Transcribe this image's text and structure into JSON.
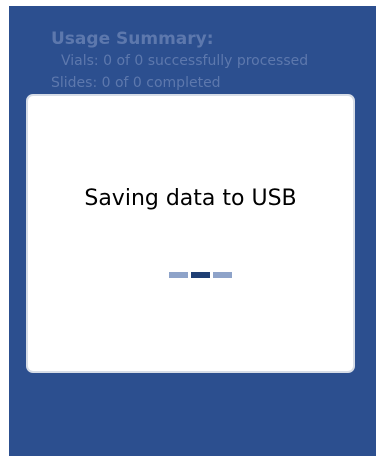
{
  "background_screen": {
    "usage_summary": {
      "title": "Usage Summary:",
      "vials_line": "Vials:  0 of 0 successfully processed",
      "slides_line": "Slides:  0 of 0 completed"
    }
  },
  "modal": {
    "message": "Saving data to USB",
    "progress": {
      "segments": 3,
      "active_segment_index": 1
    }
  },
  "colors": {
    "screen_background": "#2c4f8f",
    "summary_text": "#5d78ad",
    "modal_background": "#ffffff",
    "loader_inactive": "#8ea3c9",
    "loader_active": "#1f3f74"
  }
}
